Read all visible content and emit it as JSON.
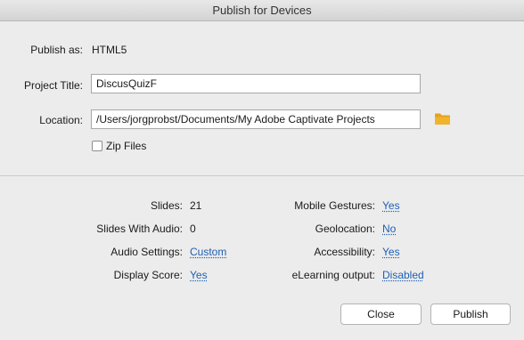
{
  "window": {
    "title": "Publish for Devices"
  },
  "publish_as": {
    "label": "Publish as:",
    "value": "HTML5"
  },
  "project_title": {
    "label": "Project Title:",
    "value": "DiscusQuizF"
  },
  "location": {
    "label": "Location:",
    "value": "/Users/jorgprobst/Documents/My Adobe Captivate Projects",
    "browse_icon": "folder-icon",
    "browse_icon_color": "#e8a21a"
  },
  "zip_files": {
    "label": "Zip Files",
    "checked": false
  },
  "stats": {
    "slides": {
      "label": "Slides:",
      "value": "21"
    },
    "slides_with_audio": {
      "label": "Slides With Audio:",
      "value": "0"
    },
    "audio_settings": {
      "label": "Audio Settings:",
      "value": "Custom"
    },
    "display_score": {
      "label": "Display Score:",
      "value": "Yes"
    },
    "mobile_gestures": {
      "label": "Mobile Gestures:",
      "value": "Yes"
    },
    "geolocation": {
      "label": "Geolocation:",
      "value": "No"
    },
    "accessibility": {
      "label": "Accessibility:",
      "value": "Yes"
    },
    "elearning_output": {
      "label": "eLearning output:",
      "value": "Disabled"
    }
  },
  "buttons": {
    "close": "Close",
    "publish": "Publish"
  },
  "colors": {
    "link": "#1f5fb3",
    "background": "#ececec"
  }
}
